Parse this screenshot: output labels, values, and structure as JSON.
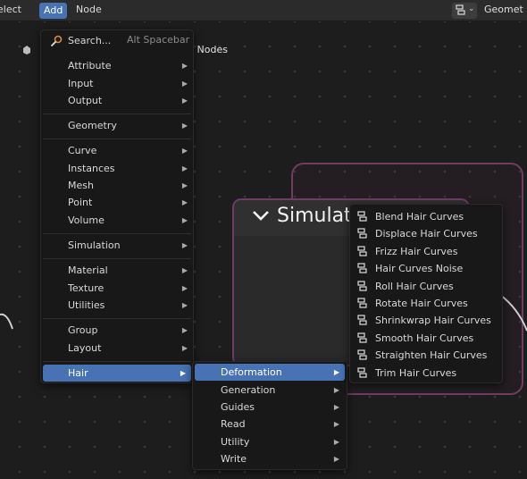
{
  "header": {
    "menus": [
      "elect",
      "Add",
      "Node"
    ],
    "tree_name": "Geomet"
  },
  "breadcrumb": {
    "text": "ry Nodes"
  },
  "background_node": {
    "title": "Simulati"
  },
  "add_menu": {
    "search": {
      "label": "Search...",
      "shortcut": "Alt Spacebar"
    },
    "items": [
      "Attribute",
      "Input",
      "Output",
      "Geometry",
      "Curve",
      "Instances",
      "Mesh",
      "Point",
      "Volume",
      "Simulation",
      "Material",
      "Texture",
      "Utilities",
      "Group",
      "Layout",
      "Hair"
    ],
    "highlighted": "Hair"
  },
  "hair_menu": {
    "items": [
      "Deformation",
      "Generation",
      "Guides",
      "Read",
      "Utility",
      "Write"
    ],
    "highlighted": "Deformation"
  },
  "deformation_menu": {
    "items": [
      "Blend Hair Curves",
      "Displace Hair Curves",
      "Frizz Hair Curves",
      "Hair Curves Noise",
      "Roll Hair Curves",
      "Rotate Hair Curves",
      "Shrinkwrap Hair Curves",
      "Smooth Hair Curves",
      "Straighten Hair Curves",
      "Trim Hair Curves"
    ],
    "icon": "node-group-icon"
  },
  "colors": {
    "highlight": "#4772b3",
    "menu_bg": "#181818",
    "node_frame": "#6e3d63",
    "canvas": "#1d1d1d"
  }
}
